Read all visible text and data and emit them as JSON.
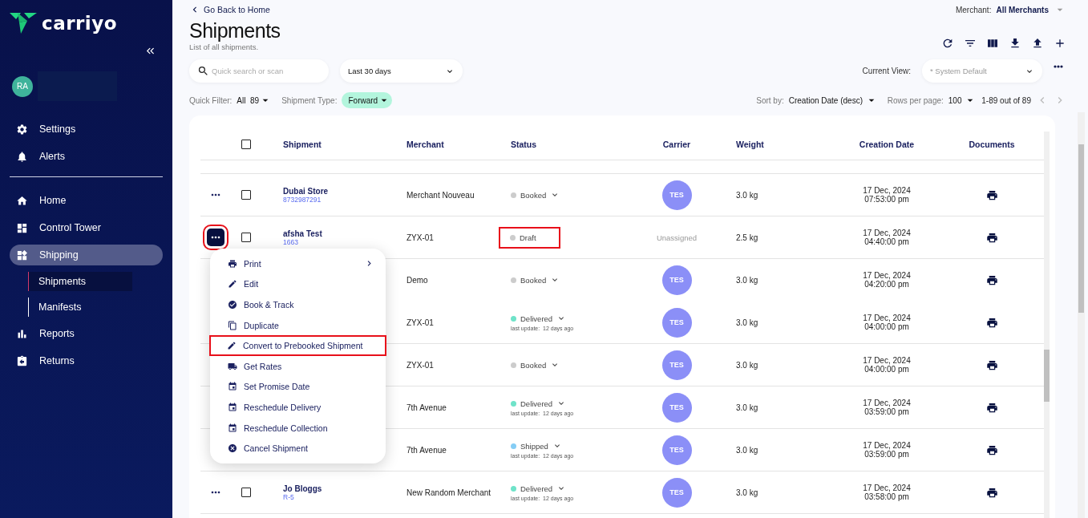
{
  "sidebar": {
    "logo": "carriyo",
    "user": {
      "initials": "RA"
    },
    "top_items": [
      {
        "label": "Settings",
        "selected": false
      },
      {
        "label": "Alerts",
        "selected": false
      }
    ],
    "items": [
      {
        "label": "Home",
        "selected": false
      },
      {
        "label": "Control Tower",
        "selected": false
      },
      {
        "label": "Shipping",
        "selected": true,
        "children": [
          {
            "label": "Shipments",
            "selected": true
          },
          {
            "label": "Manifests",
            "selected": false
          }
        ]
      },
      {
        "label": "Reports",
        "selected": false
      },
      {
        "label": "Returns",
        "selected": false
      }
    ]
  },
  "header": {
    "back_link": "Go Back to Home",
    "title": "Shipments",
    "subtitle": "List of all shipments.",
    "merchant_label": "Merchant:",
    "merchant_value": "All Merchants"
  },
  "search": {
    "placeholder": "Quick search or scan"
  },
  "date_range": {
    "value": "Last 30 days"
  },
  "current_view": {
    "label": "Current View:",
    "placeholder": "* System Default"
  },
  "filters": {
    "quick_filter_label": "Quick Filter:",
    "quick_filter_value": "All",
    "quick_filter_count": "89",
    "shipment_type_label": "Shipment Type:",
    "shipment_type_value": "Forward"
  },
  "paging": {
    "sort_label": "Sort by:",
    "sort_value": "Creation Date (desc)",
    "rows_label": "Rows per page:",
    "rows_value": "100",
    "range": "1-89 out of 89"
  },
  "table": {
    "select_all_checked": false,
    "columns": [
      "Shipment",
      "Merchant",
      "Status",
      "Carrier",
      "Weight",
      "Creation Date",
      "Documents"
    ],
    "rows": [
      {
        "shipment": "Dubai Store",
        "id": "8732987291",
        "checked": false,
        "merchant": "Merchant Nouveau",
        "status": {
          "label": "Booked",
          "color": "#cccccc",
          "dropdown": true,
          "highlighted": false
        },
        "carrier": {
          "kind": "badge",
          "text": "TES"
        },
        "weight": "3.0 kg",
        "date": "17 Dec, 2024",
        "time": "07:53:00 pm",
        "menu_highlighted": false
      },
      {
        "shipment": "afsha Test",
        "id": "1663",
        "checked": false,
        "merchant": "ZYX-01",
        "status": {
          "label": "Draft",
          "color": "#cccccc",
          "dropdown": false,
          "highlighted": true
        },
        "carrier": {
          "kind": "text",
          "text": "Unassigned"
        },
        "weight": "2.5 kg",
        "date": "17 Dec, 2024",
        "time": "04:40:00 pm",
        "menu_highlighted": true
      },
      {
        "merchant": "Demo",
        "status": {
          "label": "Booked",
          "color": "#cccccc",
          "dropdown": true,
          "highlighted": false
        },
        "carrier": {
          "kind": "badge",
          "text": "TES"
        },
        "weight": "3.0 kg",
        "date": "17 Dec, 2024",
        "time": "04:20:00 pm"
      },
      {
        "merchant": "ZYX-01",
        "status": {
          "label": "Delivered",
          "color": "#6fe3c9",
          "dropdown": true,
          "highlighted": false,
          "update_label": "last update:",
          "update_value": "12 days ago"
        },
        "carrier": {
          "kind": "badge",
          "text": "TES"
        },
        "weight": "3.0 kg",
        "date": "17 Dec, 2024",
        "time": "04:00:00 pm"
      },
      {
        "merchant": "ZYX-01",
        "status": {
          "label": "Booked",
          "color": "#cccccc",
          "dropdown": true,
          "highlighted": false
        },
        "carrier": {
          "kind": "badge",
          "text": "TES"
        },
        "weight": "3.0 kg",
        "date": "17 Dec, 2024",
        "time": "04:00:00 pm"
      },
      {
        "merchant": "7th Avenue",
        "status": {
          "label": "Delivered",
          "color": "#6fe3c9",
          "dropdown": true,
          "highlighted": false,
          "update_label": "last update:",
          "update_value": "12 days ago"
        },
        "carrier": {
          "kind": "badge",
          "text": "TES"
        },
        "weight": "3.0 kg",
        "date": "17 Dec, 2024",
        "time": "03:59:00 pm"
      },
      {
        "merchant": "7th Avenue",
        "status": {
          "label": "Shipped",
          "color": "#85cdf5",
          "dropdown": true,
          "highlighted": false,
          "update_label": "last update:",
          "update_value": "12 days ago"
        },
        "carrier": {
          "kind": "badge",
          "text": "TES"
        },
        "weight": "3.0 kg",
        "date": "17 Dec, 2024",
        "time": "03:59:00 pm"
      },
      {
        "shipment": "Jo Bloggs",
        "id": "R-5",
        "checked": false,
        "merchant": "New Random Merchant",
        "status": {
          "label": "Delivered",
          "color": "#6fe3c9",
          "dropdown": true,
          "highlighted": false,
          "update_label": "last update:",
          "update_value": "12 days ago"
        },
        "carrier": {
          "kind": "badge",
          "text": "TES"
        },
        "weight": "3.0 kg",
        "date": "17 Dec, 2024",
        "time": "03:58:00 pm",
        "menu_highlighted": false
      }
    ]
  },
  "row_menu": {
    "items": [
      {
        "label": "Print",
        "submenu": true,
        "highlighted": false
      },
      {
        "label": "Edit",
        "submenu": false,
        "highlighted": false
      },
      {
        "label": "Book & Track",
        "submenu": false,
        "highlighted": false
      },
      {
        "label": "Duplicate",
        "submenu": false,
        "highlighted": false
      },
      {
        "label": "Convert to Prebooked Shipment",
        "submenu": false,
        "highlighted": true
      },
      {
        "label": "Get Rates",
        "submenu": false,
        "highlighted": false
      },
      {
        "label": "Set Promise Date",
        "submenu": false,
        "highlighted": false
      },
      {
        "label": "Reschedule Delivery",
        "submenu": false,
        "highlighted": false
      },
      {
        "label": "Reschedule Collection",
        "submenu": false,
        "highlighted": false
      },
      {
        "label": "Cancel Shipment",
        "submenu": false,
        "highlighted": false
      }
    ]
  }
}
